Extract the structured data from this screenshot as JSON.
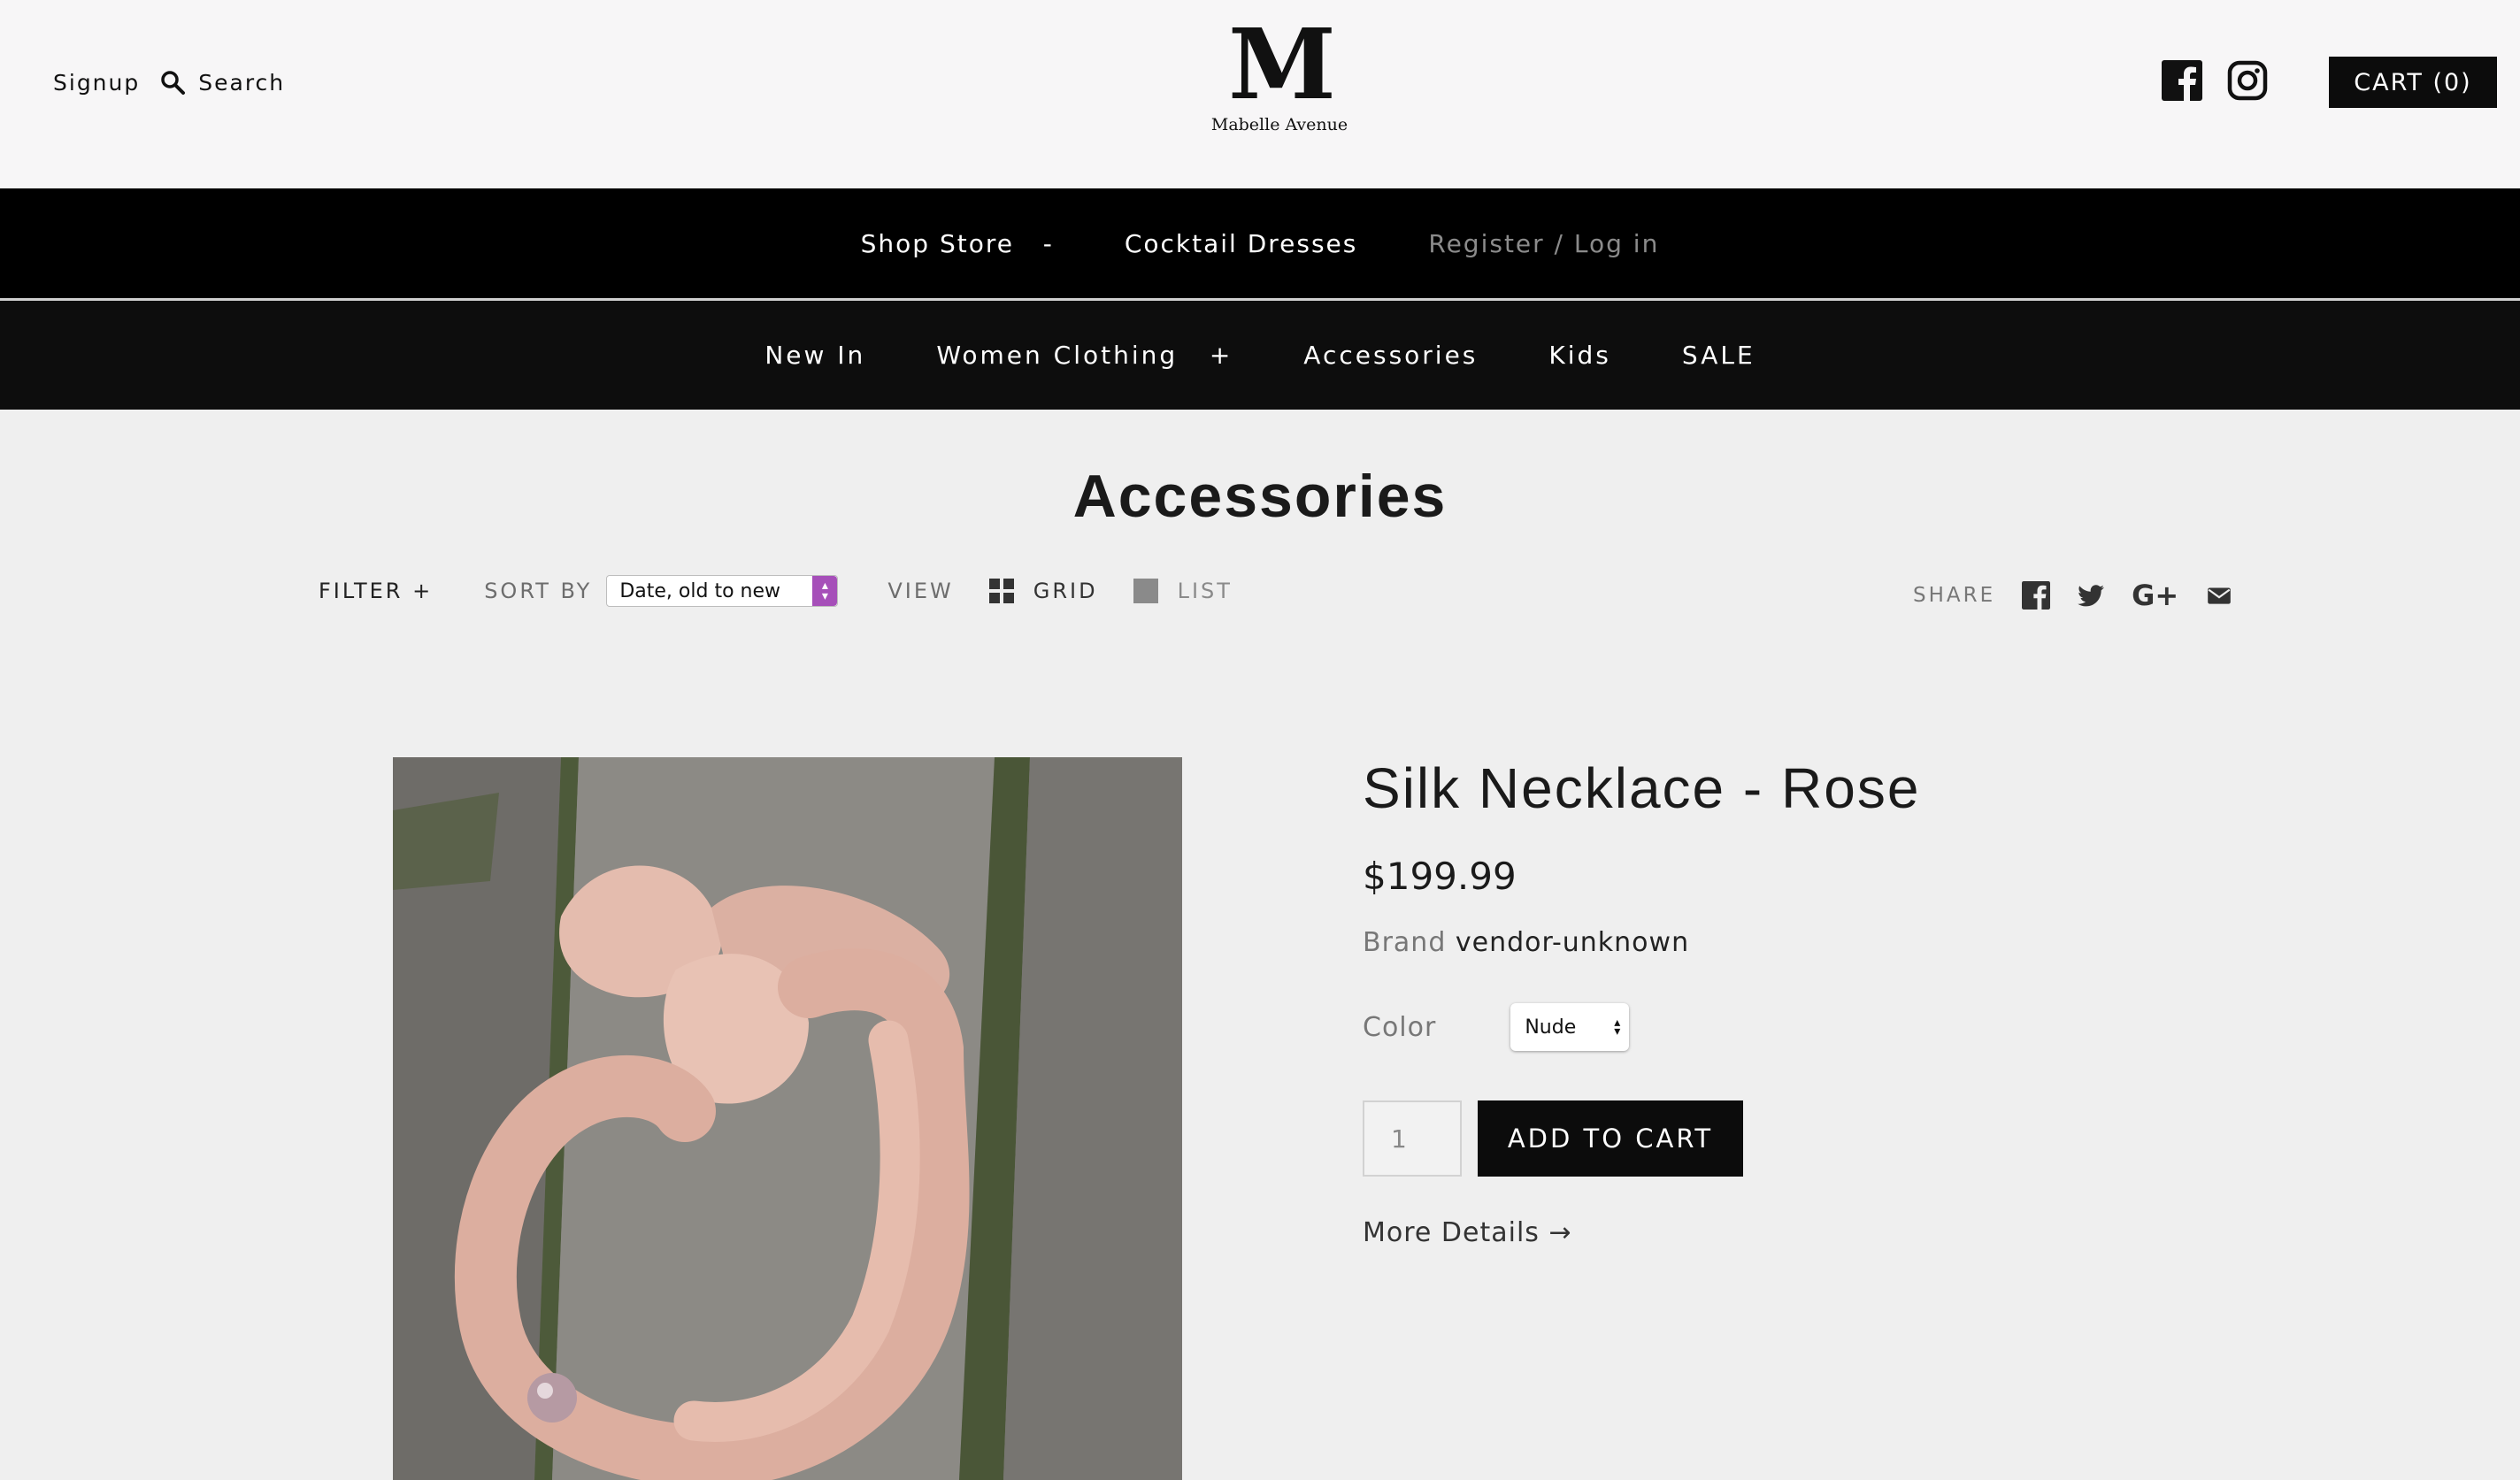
{
  "header": {
    "signup_label": "Signup",
    "search_label": "Search",
    "logo_monogram": "M",
    "logo_text": "Mabelle Avenue",
    "cart_label": "CART (0)"
  },
  "nav_primary": [
    {
      "label": "Shop Store",
      "suffix": "-"
    },
    {
      "label": "Cocktail Dresses"
    },
    {
      "label": "Register / Log in"
    }
  ],
  "nav_secondary": [
    {
      "label": "New In"
    },
    {
      "label": "Women Clothing",
      "suffix": "+"
    },
    {
      "label": "Accessories"
    },
    {
      "label": "Kids"
    },
    {
      "label": "SALE"
    }
  ],
  "collection": {
    "title": "Accessories",
    "filter_label": "FILTER +",
    "sort_label": "SORT BY",
    "sort_value": "Date, old to new",
    "view_label": "VIEW",
    "grid_label": "GRID",
    "list_label": "LIST",
    "share_label": "SHARE",
    "gplus_label": "G+"
  },
  "product": {
    "name": "Silk Necklace - Rose",
    "price": "$199.99",
    "brand_key": "Brand",
    "brand_value": "vendor-unknown",
    "color_key": "Color",
    "color_value": "Nude",
    "quantity": "1",
    "add_to_cart": "ADD TO CART",
    "more_details": "More Details →"
  },
  "colors": {
    "nav_bg": "#000000",
    "accent_select": "#a64fb9",
    "necklace": "#e2b7a9"
  }
}
